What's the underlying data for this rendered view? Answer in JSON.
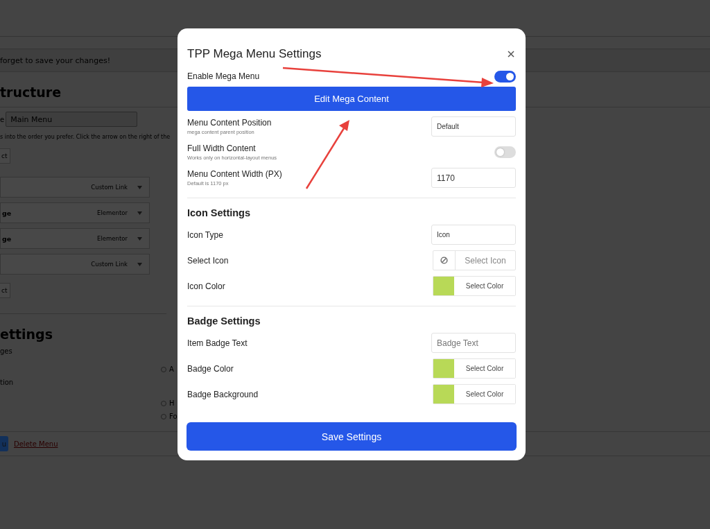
{
  "background_page": {
    "notice": "forget to save your changes!",
    "heading": "tructure",
    "menu_name": {
      "label": "e",
      "value": "Main Menu"
    },
    "instructions": "s into the order you prefer. Click the arrow on the right of the",
    "select_button_top": "ct",
    "menu_items": [
      {
        "type": "Custom Link"
      },
      {
        "title": "ge",
        "type": "Elementor"
      },
      {
        "title": "ge",
        "type": "Elementor"
      },
      {
        "type": "Custom Link"
      }
    ],
    "select_button_bottom": "ct",
    "settings_heading": "ettings",
    "settings_labels": [
      "ges",
      "tion"
    ],
    "radios": [
      {
        "label": "A",
        "checked": false
      },
      {
        "label": "H",
        "checked": false
      },
      {
        "label": "Fo",
        "checked": false
      }
    ],
    "save_button": "u",
    "delete_link": "Delete Menu"
  },
  "dialog": {
    "title": "TPP Mega Menu Settings",
    "sections": [
      {
        "rows": [
          {
            "kind": "toggle",
            "label": "Enable Mega Menu",
            "on": true
          },
          {
            "kind": "button",
            "label": "Edit Mega Content"
          },
          {
            "kind": "select",
            "label": "Menu Content Position",
            "hint": "mega content parent position",
            "value": "Default"
          },
          {
            "kind": "toggle",
            "label": "Full Width Content",
            "hint": "Works only on horizontal-layout menus",
            "on": false
          },
          {
            "kind": "input",
            "label": "Menu Content Width (PX)",
            "hint": "Default is 1170 px",
            "value": "1170"
          }
        ]
      },
      {
        "heading": "Icon Settings",
        "rows": [
          {
            "kind": "select",
            "label": "Icon Type",
            "value": "Icon"
          },
          {
            "kind": "icon_picker",
            "label": "Select Icon",
            "placeholder": "Select Icon"
          },
          {
            "kind": "color",
            "label": "Icon Color",
            "color": "#b8d957",
            "button": "Select Color"
          }
        ]
      },
      {
        "heading": "Badge Settings",
        "rows": [
          {
            "kind": "input",
            "label": "Item Badge Text",
            "placeholder": "Badge Text"
          },
          {
            "kind": "color",
            "label": "Badge Color",
            "color": "#b8d957",
            "button": "Select Color"
          },
          {
            "kind": "color",
            "label": "Badge Background",
            "color": "#b8d957",
            "button": "Select Color"
          }
        ]
      }
    ],
    "save_button": "Save Settings"
  }
}
